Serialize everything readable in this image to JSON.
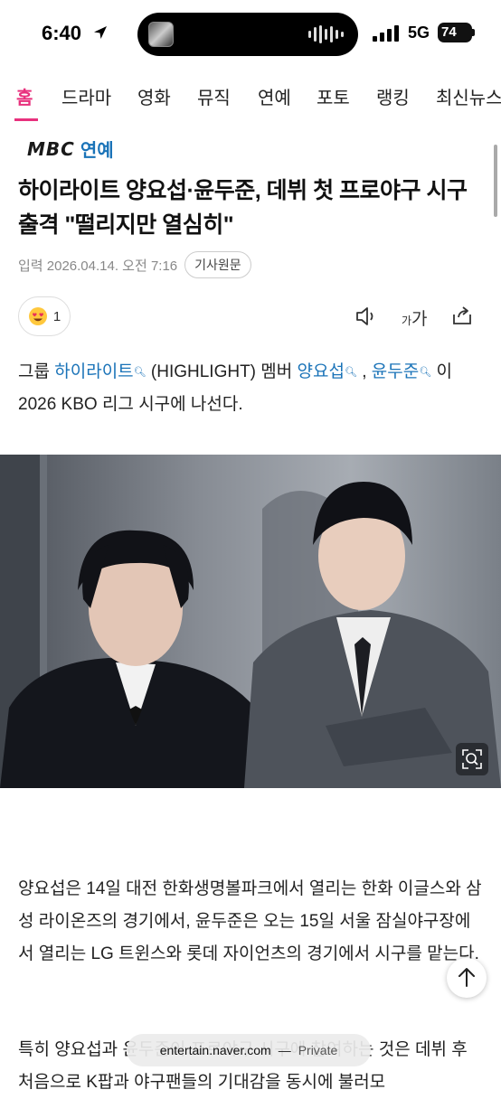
{
  "status": {
    "time": "6:40",
    "network": "5G",
    "battery": "74"
  },
  "nav": {
    "tabs": [
      "홈",
      "드라마",
      "영화",
      "뮤직",
      "연예",
      "포토",
      "랭킹",
      "최신뉴스"
    ]
  },
  "press": {
    "logo": "MBC",
    "name": "연예"
  },
  "article": {
    "headline": "하이라이트 양요섭·윤두준, 데뷔 첫 프로야구 시구 출격 \"떨리지만 열심히\"",
    "date": "입력 2026.04.14. 오전 7:16",
    "original_button": "기사원문",
    "reaction_count": "1",
    "font_button": {
      "small": "가",
      "large": "가"
    },
    "intro": {
      "p1": "그룹 ",
      "k1": "하이라이트",
      "p2": " (HIGHLIGHT) 멤버 ",
      "k2": "양요섭",
      "p3": " , ",
      "k3": "윤두준",
      "p4": " 이 2026 KBO 리그 시구에 나선다."
    },
    "para1": "양요섭은 14일 대전 한화생명볼파크에서 열리는 한화 이글스와 삼성 라이온즈의 경기에서, 윤두준은 오는 15일 서울 잠실야구장에서 열리는 LG 트윈스와 롯데 자이언츠의 경기에서 시구를 맡는다.",
    "para2": "특히 양요섭과 윤두준이 프로야구 시구에 참여하는 것은 데뷔 후 처음으로 K팝과 야구팬들의 기대감을 동시에 불러모"
  },
  "browser": {
    "host": "entertain.naver.com",
    "separator": "—",
    "mode": "Private"
  },
  "colors": {
    "accent": "#e8317d",
    "link": "#1a73b8"
  }
}
